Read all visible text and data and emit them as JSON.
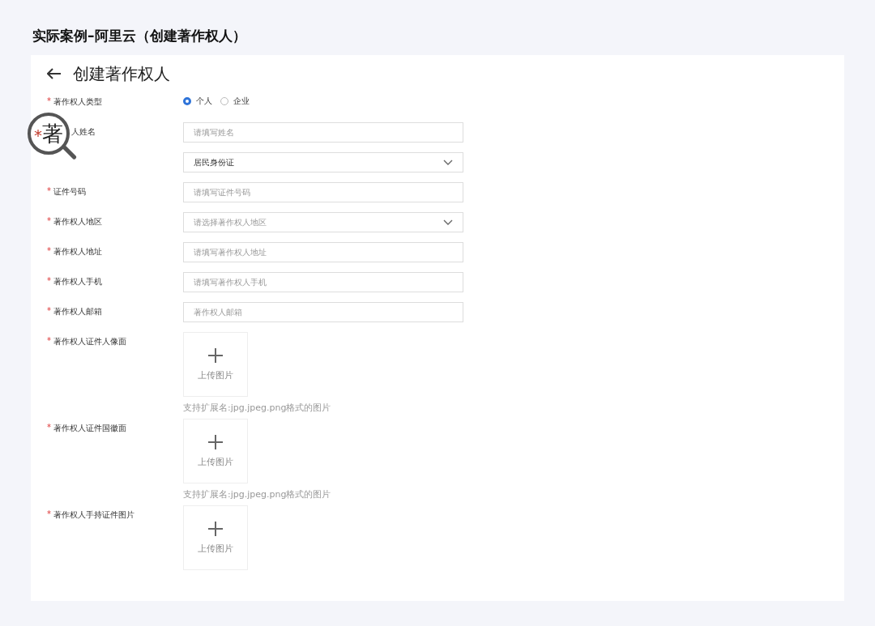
{
  "caption": "实际案例–阿里云（创建著作权人）",
  "page": {
    "title": "创建著作权人"
  },
  "magnifier": {
    "mark": "*",
    "text": "著"
  },
  "fields": [
    {
      "kind": "radio",
      "label": "著作权人类型",
      "required": true,
      "options": [
        {
          "label": "个人",
          "selected": true
        },
        {
          "label": "企业",
          "selected": false
        }
      ]
    },
    {
      "kind": "input",
      "label": "人姓名",
      "magnified": true,
      "placeholder": "请填写姓名"
    },
    {
      "kind": "select",
      "value": "居民身份证"
    },
    {
      "kind": "input",
      "label": "证件号码",
      "required": true,
      "placeholder": "请填写证件号码"
    },
    {
      "kind": "select",
      "label": "著作权人地区",
      "required": true,
      "placeholder": "请选择著作权人地区"
    },
    {
      "kind": "input",
      "label": "著作权人地址",
      "required": true,
      "placeholder": "请填写著作权人地址"
    },
    {
      "kind": "input",
      "label": "著作权人手机",
      "required": true,
      "placeholder": "请填写著作权人手机"
    },
    {
      "kind": "input",
      "label": "著作权人邮箱",
      "required": true,
      "placeholder": "著作权人邮箱"
    },
    {
      "kind": "upload",
      "label": "著作权人证件人像面",
      "required": true,
      "button": "上传图片",
      "hint": "支持扩展名:jpg.jpeg.png格式的图片"
    },
    {
      "kind": "upload",
      "label": "著作权人证件国徽面",
      "required": true,
      "button": "上传图片",
      "hint": "支持扩展名:jpg.jpeg.png格式的图片"
    },
    {
      "kind": "upload",
      "label": "著作权人手持证件图片",
      "required": true,
      "button": "上传图片"
    }
  ]
}
